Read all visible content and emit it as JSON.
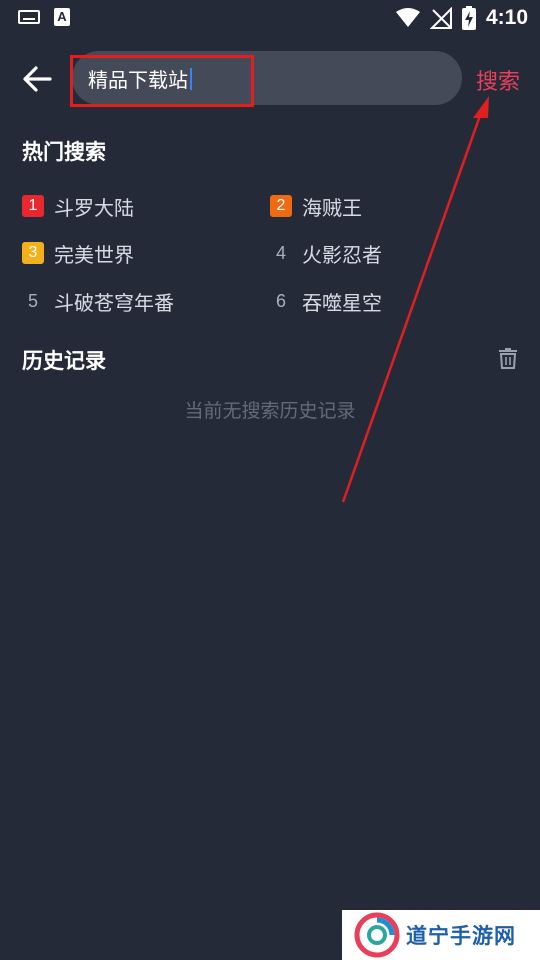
{
  "status_bar": {
    "time": "4:10",
    "icons": [
      "keyboard-icon",
      "a-notification-icon",
      "wifi-icon",
      "signal-off-icon",
      "battery-charging-icon"
    ]
  },
  "search": {
    "query": "精品下载站",
    "action_label": "搜索",
    "action_color": "#e8405a"
  },
  "hot_search": {
    "title": "热门搜索",
    "items": [
      {
        "rank": "1",
        "label": "斗罗大陆",
        "badge_color": "#e8282e"
      },
      {
        "rank": "2",
        "label": "海贼王",
        "badge_color": "#f06a12"
      },
      {
        "rank": "3",
        "label": "完美世界",
        "badge_color": "#f2b01a"
      },
      {
        "rank": "4",
        "label": "火影忍者"
      },
      {
        "rank": "5",
        "label": "斗破苍穹年番"
      },
      {
        "rank": "6",
        "label": "吞噬星空"
      }
    ]
  },
  "history": {
    "title": "历史记录",
    "empty_text": "当前无搜索历史记录"
  },
  "watermark": {
    "text": "道宁手游网"
  }
}
